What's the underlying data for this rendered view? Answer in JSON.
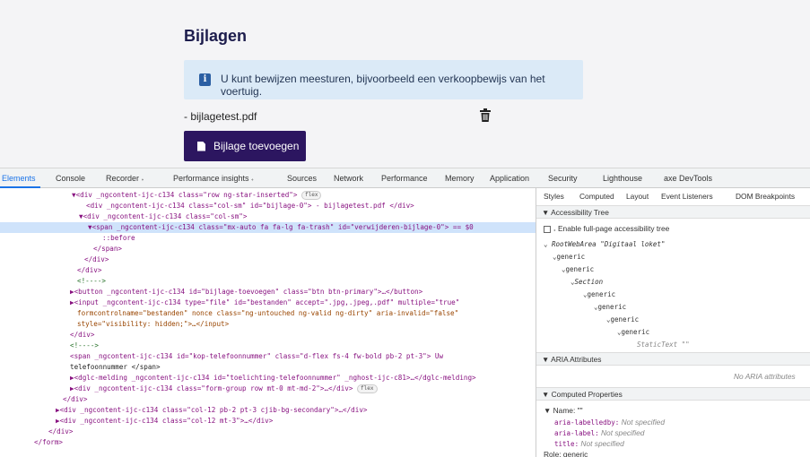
{
  "page": {
    "title": "Bijlagen",
    "alert_icon": "i",
    "alert_text": "U kunt bewijzen meesturen, bijvoorbeeld een verkoopbewijs van het voertuig.",
    "file_name": "- bijlagetest.pdf",
    "add_button": "Bijlage toevoegen"
  },
  "devtools": {
    "tabs": [
      "Elements",
      "Console",
      "Recorder 𝆹",
      "Performance insights 𝆹",
      "Sources",
      "Network",
      "Performance",
      "Memory",
      "Application",
      "Security",
      "Lighthouse",
      "axe DevTools"
    ],
    "active_tab": "Elements",
    "lines": [
      "▼<div _ngcontent-ijc-c134 class=\"row ng-star-inserted\">",
      "<div _ngcontent-ijc-c134 class=\"col-sm\" id=\"bijlage-0\"> - bijlagetest.pdf </div>",
      "▼<div _ngcontent-ijc-c134 class=\"col-sm\">",
      "▼<span _ngcontent-ijc-c134 class=\"mx-auto fa fa-lg fa-trash\" id=\"verwijderen-bijlage-0\"> == $0",
      "::before",
      "</span>",
      "</div>",
      "</div>",
      "<!---->",
      "▶<button _ngcontent-ijc-c134 id=\"bijlage-toevoegen\" class=\"btn btn-primary\">…</button>",
      "▶<input _ngcontent-ijc-c134 type=\"file\" id=\"bestanden\" accept=\".jpg,.jpeg,.pdf\" multiple=\"true\"",
      "formcontrolname=\"bestanden\" nonce class=\"ng-untouched ng-valid ng-dirty\" aria-invalid=\"false\"",
      "style=\"visibility: hidden;\">…</input>",
      "</div>",
      "<!---->",
      "<span _ngcontent-ijc-c134 id=\"kop-telefoonnummer\" class=\"d-flex fs-4 fw-bold pb-2 pt-3\"> Uw",
      "telefoonnummer </span>",
      "▶<dglc-melding _ngcontent-ijc-c134 id=\"toelichting-telefoonnummer\" _nghost-ijc-c81>…</dglc-melding>",
      "▶<div _ngcontent-ijc-c134 class=\"form-group row mt-0 mt-md-2\">…</div>",
      "</div>",
      "▶<div _ngcontent-ijc-c134 class=\"col-12 pb-2 pt-3 cjib-bg-secondary\">…</div>",
      "▶<div _ngcontent-ijc-c134 class=\"col-12 mt-3\">…</div>",
      "</div>",
      "</form>"
    ],
    "flex_badge": "flex",
    "side_tabs": [
      "Styles",
      "Computed",
      "Layout",
      "Event Listeners",
      "DOM Breakpoints"
    ],
    "accessibility_tree_label": "▼ Accessibility Tree",
    "enable_label": "𝆹 Enable full-page accessibility tree",
    "root": "RootWebArea \"Digitaal loket\"",
    "tree": [
      "generic",
      "generic",
      "Section",
      "generic",
      "generic",
      "generic",
      "generic",
      "StaticText \"\""
    ],
    "aria_header": "▼ ARIA Attributes",
    "no_aria": "No ARIA attributes",
    "computed_header": "▼ Computed Properties",
    "name_label": "▼ Name: \"\"",
    "props": [
      {
        "k": "aria-labelledby:",
        "v": "Not specified"
      },
      {
        "k": "aria-label:",
        "v": "Not specified"
      },
      {
        "k": "title:",
        "v": "Not specified"
      }
    ],
    "role": "Role: generic"
  }
}
